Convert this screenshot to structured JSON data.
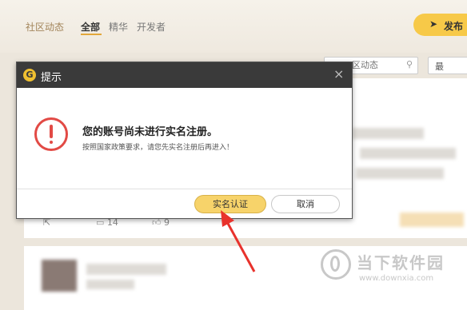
{
  "header": {
    "nav": {
      "community": "社区动态",
      "all": "全部",
      "featured": "精华",
      "developer": "开发者"
    },
    "post_button": "发布",
    "search_placeholder": "区动态",
    "latest_label": "最"
  },
  "feed": {
    "stats": {
      "comments": "14",
      "likes": "9"
    }
  },
  "dialog": {
    "title": "提示",
    "logo_letter": "G",
    "close_icon": "×",
    "message": "您的账号尚未进行实名注册。",
    "sub_message": "按照国家政策要求，请您先实名注册后再进入！",
    "primary_button": "实名认证",
    "secondary_button": "取消"
  },
  "watermark": {
    "name": "当下软件园",
    "url": "www.downxia.com"
  },
  "colors": {
    "accent": "#f7c948",
    "warning": "#e24a45",
    "dialog_header": "#3a3a3a",
    "arrow": "#e8322c"
  }
}
